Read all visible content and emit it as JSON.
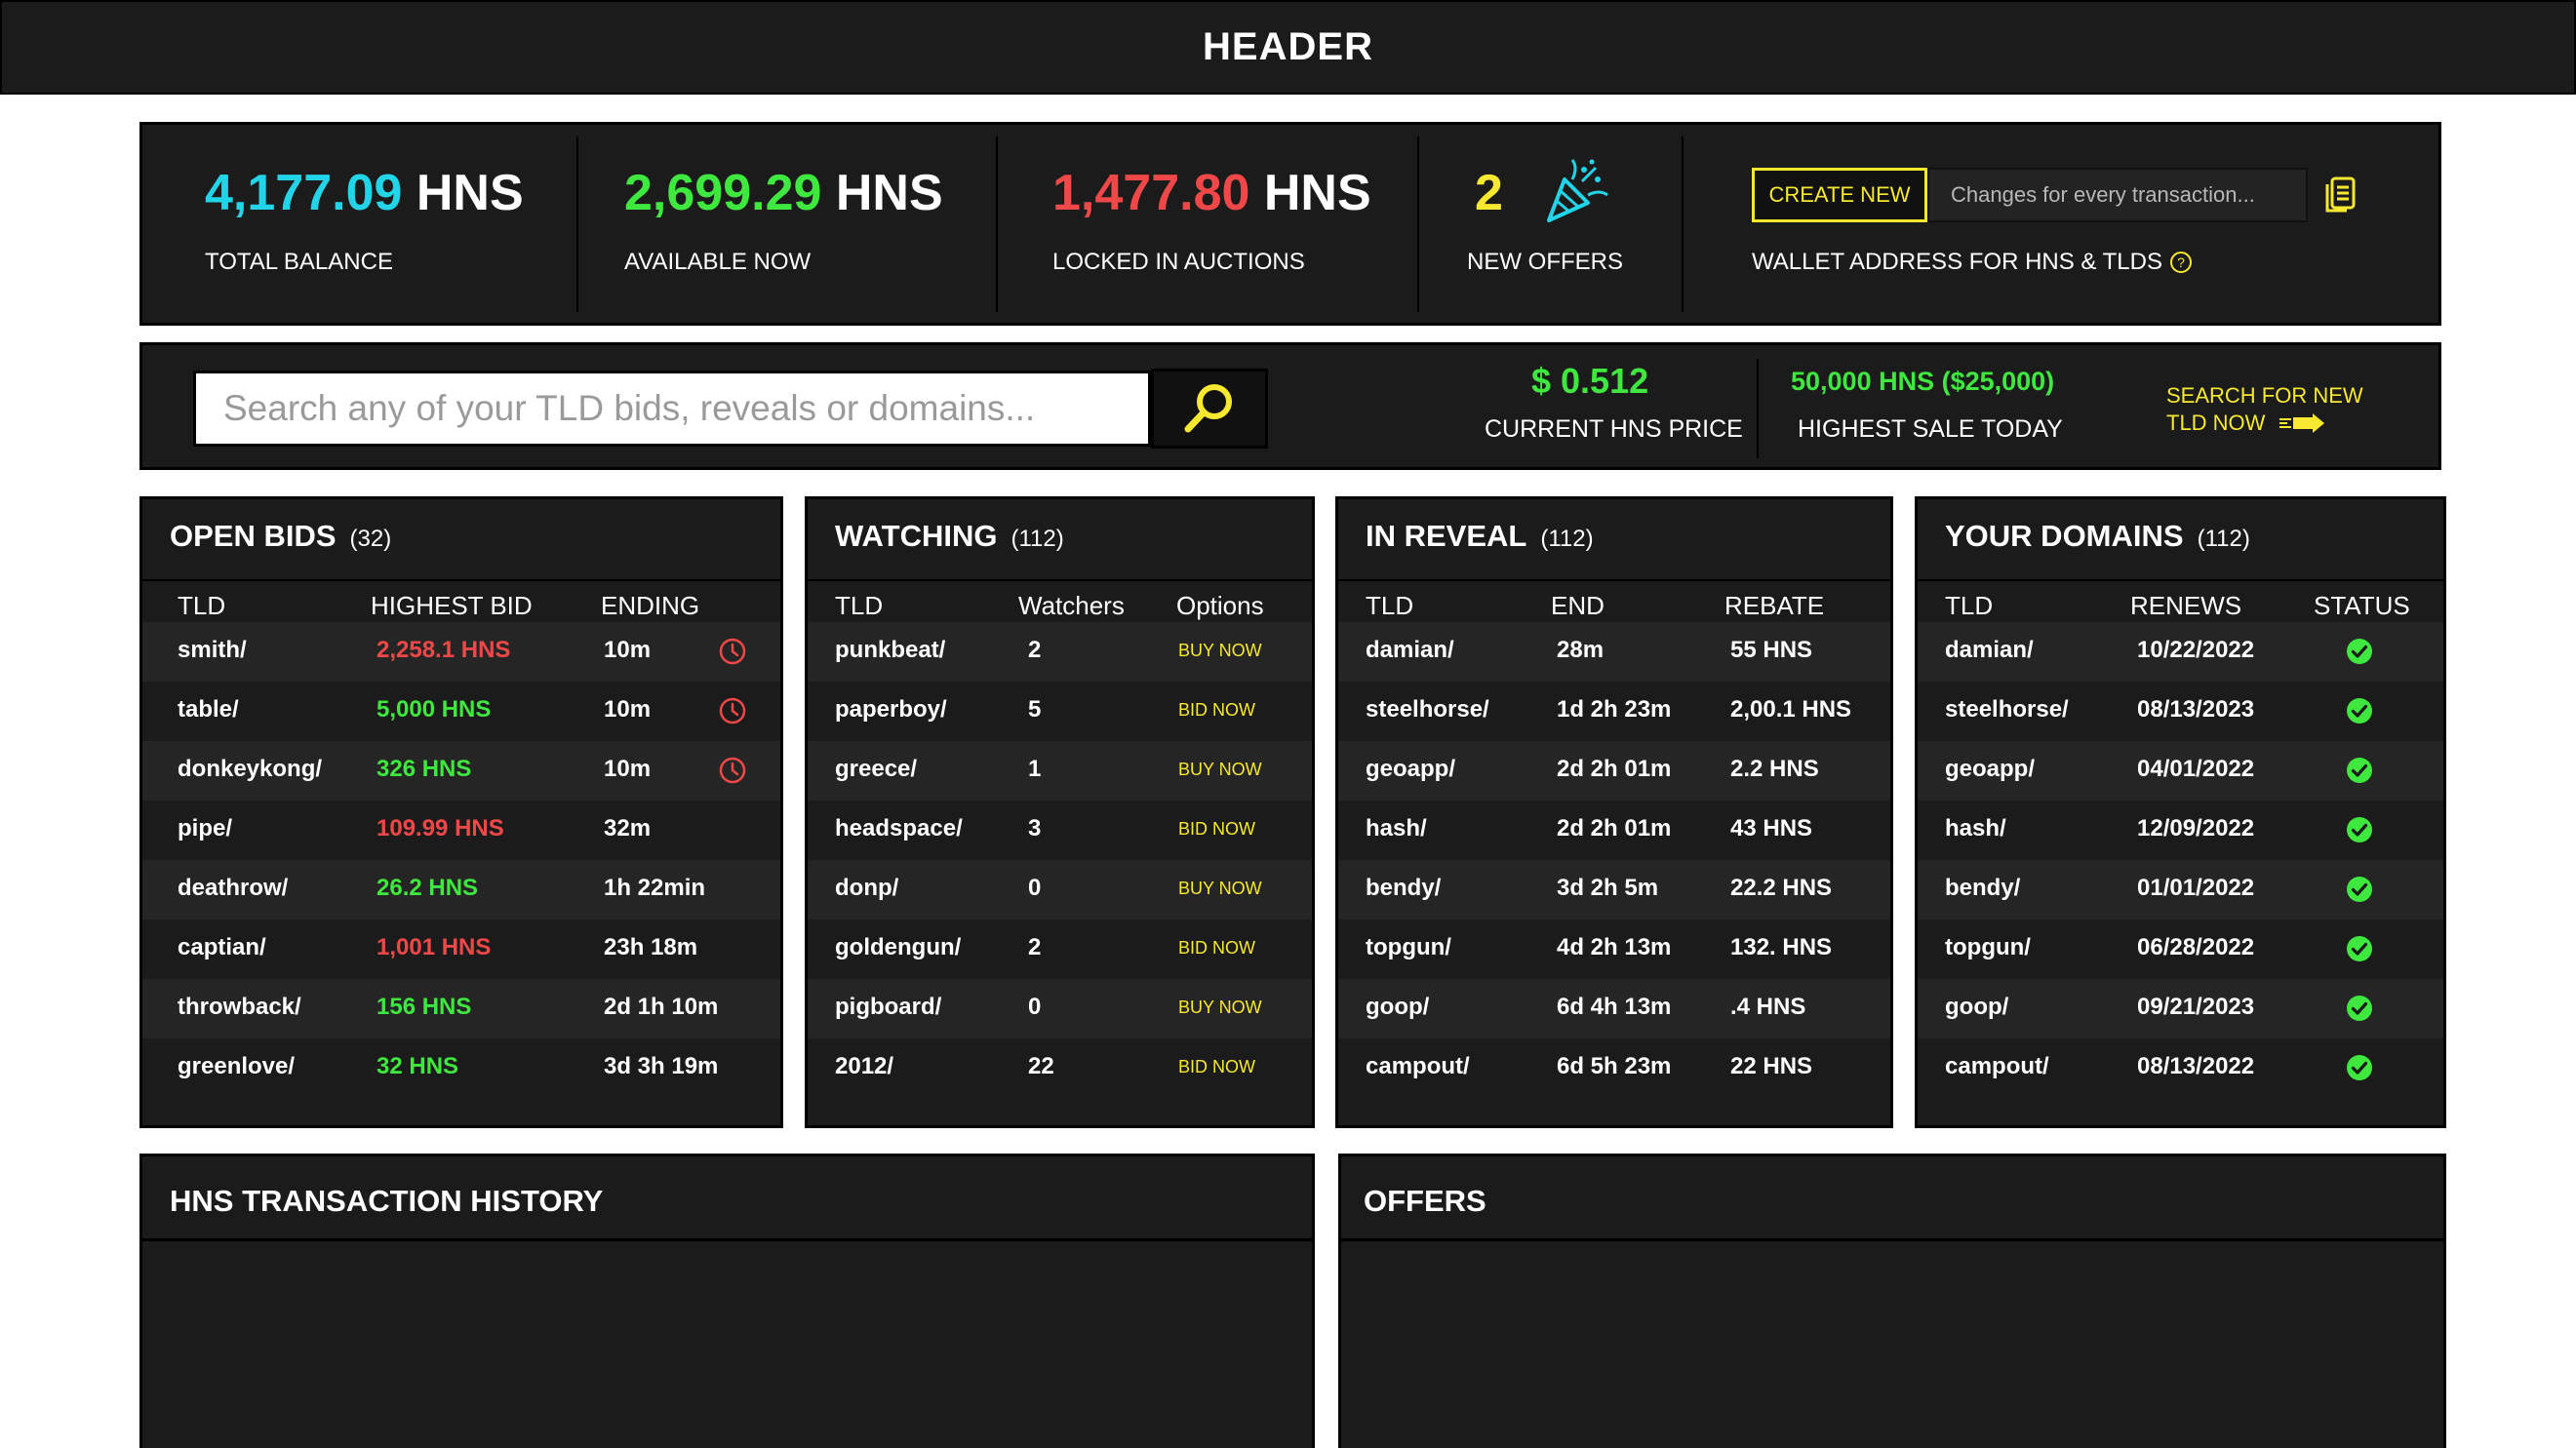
{
  "header": {
    "title": "HEADER"
  },
  "stats": {
    "total_balance": {
      "amount": "4,177.09",
      "unit": "HNS",
      "label": "TOTAL BALANCE"
    },
    "available": {
      "amount": "2,699.29",
      "unit": "HNS",
      "label": "AVAILABLE NOW"
    },
    "locked": {
      "amount": "1,477.80",
      "unit": "HNS",
      "label": "LOCKED IN AUCTIONS"
    },
    "offers": {
      "count": "2",
      "label": "NEW OFFERS"
    },
    "wallet": {
      "create_label": "CREATE NEW",
      "placeholder": "Changes for every transaction...",
      "label": "WALLET ADDRESS FOR HNS & TLDS",
      "help": "?"
    }
  },
  "searchbar": {
    "placeholder": "Search any of your TLD bids, reveals or domains...",
    "price_value": "$ 0.512",
    "price_label": "CURRENT HNS PRICE",
    "sale_value": "50,000 HNS ($25,000)",
    "sale_label": "HIGHEST SALE TODAY",
    "search_new_line1": "SEARCH FOR NEW",
    "search_new_line2": "TLD NOW"
  },
  "open_bids": {
    "title": "OPEN BIDS",
    "count": "(32)",
    "columns": [
      "TLD",
      "HIGHEST BID",
      "ENDING"
    ],
    "rows": [
      {
        "tld": "smith/",
        "bid": "2,258.1 HNS",
        "bid_color": "red",
        "ending": "10m",
        "clock": true
      },
      {
        "tld": "table/",
        "bid": "5,000 HNS",
        "bid_color": "green",
        "ending": "10m",
        "clock": true
      },
      {
        "tld": "donkeykong/",
        "bid": "326 HNS",
        "bid_color": "green",
        "ending": "10m",
        "clock": true
      },
      {
        "tld": "pipe/",
        "bid": "109.99 HNS",
        "bid_color": "red",
        "ending": "32m",
        "clock": false
      },
      {
        "tld": "deathrow/",
        "bid": "26.2 HNS",
        "bid_color": "green",
        "ending": "1h 22min",
        "clock": false
      },
      {
        "tld": "captian/",
        "bid": "1,001 HNS",
        "bid_color": "red",
        "ending": "23h 18m",
        "clock": false
      },
      {
        "tld": "throwback/",
        "bid": "156 HNS",
        "bid_color": "green",
        "ending": "2d 1h 10m",
        "clock": false
      },
      {
        "tld": "greenlove/",
        "bid": "32 HNS",
        "bid_color": "green",
        "ending": "3d 3h 19m",
        "clock": false
      }
    ]
  },
  "watching": {
    "title": "WATCHING",
    "count": "(112)",
    "columns": [
      "TLD",
      "Watchers",
      "Options"
    ],
    "rows": [
      {
        "tld": "punkbeat/",
        "watchers": "2",
        "option": "BUY NOW"
      },
      {
        "tld": "paperboy/",
        "watchers": "5",
        "option": "BID NOW"
      },
      {
        "tld": "greece/",
        "watchers": "1",
        "option": "BUY NOW"
      },
      {
        "tld": "headspace/",
        "watchers": "3",
        "option": "BID NOW"
      },
      {
        "tld": "donp/",
        "watchers": "0",
        "option": "BUY NOW"
      },
      {
        "tld": "goldengun/",
        "watchers": "2",
        "option": "BID NOW"
      },
      {
        "tld": "pigboard/",
        "watchers": "0",
        "option": "BUY NOW"
      },
      {
        "tld": "2012/",
        "watchers": "22",
        "option": "BID NOW"
      }
    ]
  },
  "in_reveal": {
    "title": "IN REVEAL",
    "count": "(112)",
    "columns": [
      "TLD",
      "END",
      "REBATE"
    ],
    "rows": [
      {
        "tld": "damian/",
        "end": "28m",
        "rebate": "55 HNS"
      },
      {
        "tld": "steelhorse/",
        "end": "1d 2h 23m",
        "rebate": "2,00.1 HNS"
      },
      {
        "tld": "geoapp/",
        "end": "2d 2h 01m",
        "rebate": "2.2 HNS"
      },
      {
        "tld": "hash/",
        "end": "2d 2h 01m",
        "rebate": "43 HNS"
      },
      {
        "tld": "bendy/",
        "end": "3d 2h 5m",
        "rebate": "22.2 HNS"
      },
      {
        "tld": "topgun/",
        "end": "4d 2h 13m",
        "rebate": "132. HNS"
      },
      {
        "tld": "goop/",
        "end": "6d 4h 13m",
        "rebate": ".4 HNS"
      },
      {
        "tld": "campout/",
        "end": "6d 5h 23m",
        "rebate": "22 HNS"
      }
    ]
  },
  "your_domains": {
    "title": "YOUR DOMAINS",
    "count": "(112)",
    "columns": [
      "TLD",
      "RENEWS",
      "STATUS"
    ],
    "rows": [
      {
        "tld": "damian/",
        "renews": "10/22/2022"
      },
      {
        "tld": "steelhorse/",
        "renews": "08/13/2023"
      },
      {
        "tld": "geoapp/",
        "renews": "04/01/2022"
      },
      {
        "tld": "hash/",
        "renews": "12/09/2022"
      },
      {
        "tld": "bendy/",
        "renews": "01/01/2022"
      },
      {
        "tld": "topgun/",
        "renews": "06/28/2022"
      },
      {
        "tld": "goop/",
        "renews": "09/21/2023"
      },
      {
        "tld": "campout/",
        "renews": "08/13/2022"
      }
    ]
  },
  "history": {
    "title": "HNS TRANSACTION HISTORY"
  },
  "offers_panel": {
    "title": "OFFERS"
  },
  "colors": {
    "cyan": "#22d4e8",
    "green": "#3ee83e",
    "red": "#f04848",
    "yellow": "#f7e830",
    "panel": "#1b1b1b"
  },
  "icons": [
    "party-popper-icon",
    "copy-icon",
    "help-icon",
    "search-icon",
    "arrow-right-icon",
    "clock-icon",
    "check-circle-icon"
  ]
}
